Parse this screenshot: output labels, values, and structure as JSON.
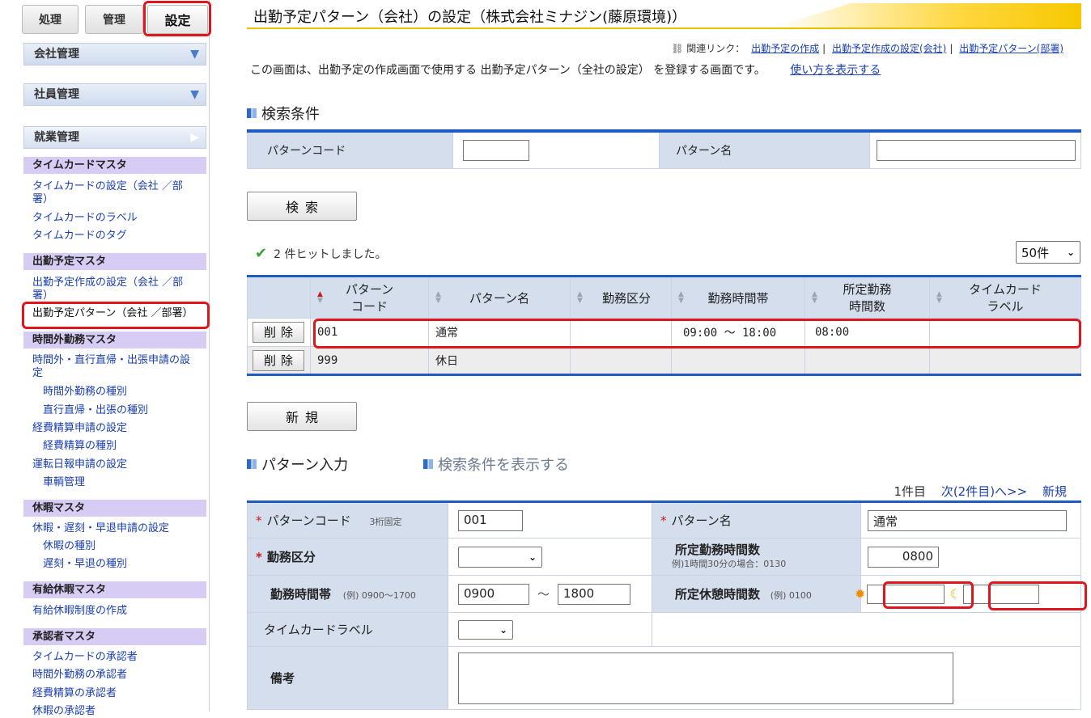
{
  "sidebar": {
    "tabs": [
      "処理",
      "管理",
      "設定"
    ],
    "groups": {
      "company": "会社管理",
      "employee": "社員管理",
      "work": "就業管理"
    },
    "timecard_master": {
      "title": "タイムカードマスタ",
      "items": [
        "タイムカードの設定（会社 ／部署）",
        "タイムカードのラベル",
        "タイムカードのタグ"
      ]
    },
    "schedule_master": {
      "title": "出勤予定マスタ",
      "items": [
        "出勤予定作成の設定（会社 ／部署）",
        "出勤予定パターン（会社 ／部署）"
      ]
    },
    "overtime_master": {
      "title": "時間外勤務マスタ",
      "items": [
        "時間外・直行直帰・出張申請の設定",
        "時間外勤務の種別",
        "直行直帰・出張の種別",
        "経費精算申請の設定",
        "経費精算の種別",
        "運転日報申請の設定",
        "車輌管理"
      ]
    },
    "leave_master": {
      "title": "休暇マスタ",
      "items": [
        "休暇・遅刻・早退申請の設定",
        "休暇の種別",
        "遅刻・早退の種別"
      ]
    },
    "paid_leave_master": {
      "title": "有給休暇マスタ",
      "items": [
        "有給休暇制度の作成"
      ]
    },
    "approver_master": {
      "title": "承認者マスタ",
      "items": [
        "タイムカードの承認者",
        "時間外勤務の承認者",
        "経費精算の承認者",
        "休暇の承認者"
      ]
    }
  },
  "header": {
    "title": "出勤予定パターン（会社）の設定（株式会社ミナジン(藤原環境)）",
    "related_label": "関連リンク：",
    "related_links": [
      "出勤予定の作成",
      "出勤予定作成の設定(会社)",
      "出勤予定パターン(部署)"
    ],
    "description": "この画面は、出勤予定の作成画面で使用する 出勤予定パターン（全社の設定） を登録する画面です。",
    "help_link": "使い方を表示する"
  },
  "search": {
    "section_title": "検索条件",
    "code_label": "パターンコード",
    "code_value": "",
    "name_label": "パターン名",
    "name_value": "",
    "button": "検索"
  },
  "results": {
    "hits": "2 件ヒットしました。",
    "per_page": "50件",
    "columns": [
      "パターンコード",
      "パターン名",
      "勤務区分",
      "勤務時間帯",
      "所定勤務時間数",
      "タイムカードラベル"
    ],
    "column_lines": [
      [
        "パターン",
        "コード"
      ],
      [
        "パターン名"
      ],
      [
        "勤務区分"
      ],
      [
        "勤務時間帯"
      ],
      [
        "所定勤務",
        "時間数"
      ],
      [
        "タイムカード",
        "ラベル"
      ]
    ],
    "delete_label": "削除",
    "rows": [
      {
        "code": "001",
        "name": "通常",
        "type": "",
        "hours": "09:00 〜 18:00",
        "work_time": "08:00",
        "label": ""
      },
      {
        "code": "999",
        "name": "休日",
        "type": "",
        "hours": "",
        "work_time": "",
        "label": ""
      }
    ],
    "new_button": "新規"
  },
  "form": {
    "section_title": "パターン入力",
    "toggle_search": "検索条件を表示する",
    "pager": {
      "current": "1件目",
      "next": "次(2件目)へ>>",
      "new": "新規"
    },
    "code_label": "パターンコード",
    "code_hint": "3桁固定",
    "code_value": "001",
    "name_label": "パターン名",
    "name_value": "通常",
    "type_label": "勤務区分",
    "type_value": "",
    "work_time_label": "所定勤務時間数",
    "work_time_hint": "例)1時間30分の場合：0130",
    "work_time_value": "0800",
    "hours_label": "勤務時間帯",
    "hours_hint": "(例) 0900〜1700",
    "hours_from": "0900",
    "hours_sep": "〜",
    "hours_to": "1800",
    "break_label": "所定休憩時間数",
    "break_hint": "(例) 0100",
    "break_day": "",
    "break_night": "",
    "timecard_label": "タイムカードラベル",
    "timecard_value": "",
    "remarks_label": "備考",
    "remarks_value": ""
  },
  "colors": {
    "accent": "#1f5cc2",
    "highlight": "#e0161c",
    "title_bar": "#f6c800"
  }
}
